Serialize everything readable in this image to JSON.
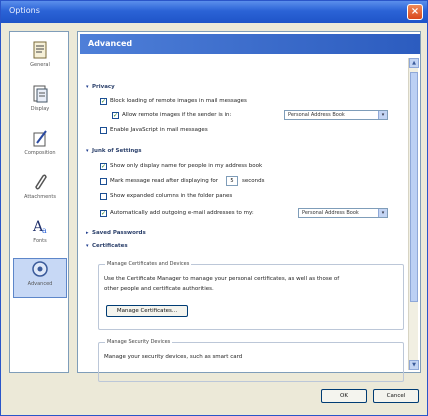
{
  "window": {
    "title": "Options",
    "close_glyph": "×"
  },
  "sidebar": {
    "items": [
      {
        "label": "General",
        "icon": "general-icon"
      },
      {
        "label": "Display",
        "icon": "display-icon"
      },
      {
        "label": "Composition",
        "icon": "composition-icon"
      },
      {
        "label": "Attachments",
        "icon": "attachments-icon"
      },
      {
        "label": "Fonts",
        "icon": "fonts-icon"
      },
      {
        "label": "Advanced",
        "icon": "advanced-icon",
        "selected": true
      }
    ]
  },
  "main": {
    "header": "Advanced",
    "privacy": {
      "title": "Privacy",
      "block_images": "Block loading of remote images in mail messages",
      "allow_remote": "Allow remote images if the sender is in:",
      "allow_remote_select": "Personal Address Book",
      "enable_js": "Enable JavaScript in mail messages"
    },
    "misc": {
      "title": "Junk of Settings",
      "display_name": "Show only display name for people in my address book",
      "mark_read": "Mark message read after displaying for",
      "mark_read_value": "5",
      "mark_read_unit": "seconds",
      "threads": "Show expanded columns in the folder panes",
      "auto_add": "Automatically add outgoing e-mail addresses to my:",
      "auto_add_select": "Personal Address Book"
    },
    "saved_passwords": "Saved Passwords",
    "certificates": {
      "title": "Certificates",
      "group_caption": "Manage Certificates and Devices",
      "desc_line1": "Use the Certificate Manager to manage your personal certificates, as well as those of",
      "desc_line2": "other people and certificate authorities.",
      "manage_btn": "Manage Certificates...",
      "devices_caption": "Manage Security Devices",
      "devices_desc": "Manage your security devices, such as smart card"
    }
  },
  "footer": {
    "ok": "OK",
    "cancel": "Cancel"
  },
  "colors": {
    "accent": "#2b63d6",
    "selection": "#c7d8f5"
  }
}
